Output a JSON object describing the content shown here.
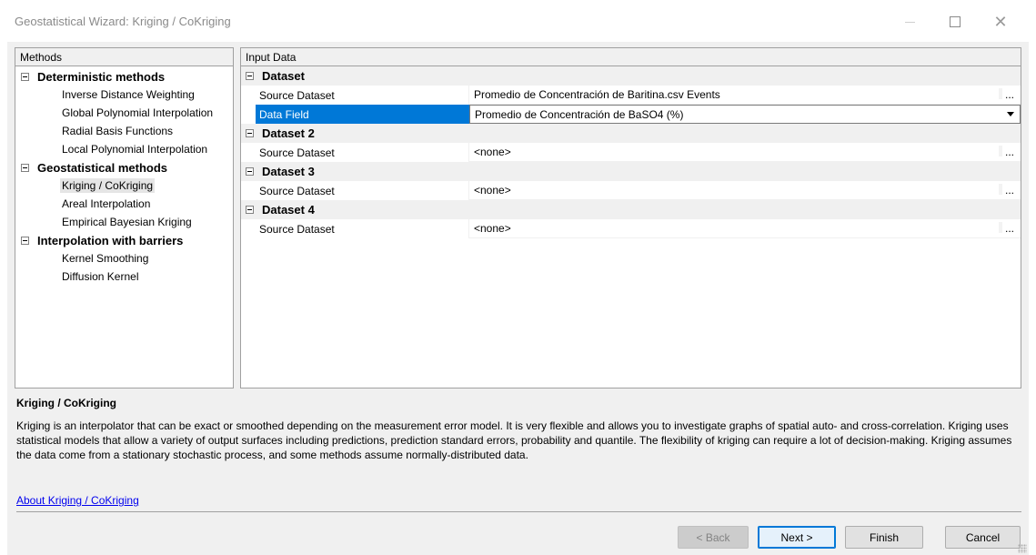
{
  "window": {
    "title": "Geostatistical Wizard: Kriging / CoKriging"
  },
  "methods": {
    "header": "Methods",
    "groups": [
      {
        "label": "Deterministic methods",
        "items": [
          "Inverse Distance Weighting",
          "Global Polynomial Interpolation",
          "Radial Basis Functions",
          "Local Polynomial Interpolation"
        ]
      },
      {
        "label": "Geostatistical methods",
        "items": [
          "Kriging / CoKriging",
          "Areal Interpolation",
          "Empirical Bayesian Kriging"
        ]
      },
      {
        "label": "Interpolation with barriers",
        "items": [
          "Kernel Smoothing",
          "Diffusion Kernel"
        ]
      }
    ],
    "selected": "Kriging / CoKriging"
  },
  "input_data": {
    "header": "Input Data",
    "sections": [
      {
        "label": "Dataset",
        "rows": [
          {
            "name": "Source Dataset",
            "value": "Promedio de Concentración de Baritina.csv Events"
          },
          {
            "name": "Data Field",
            "value": "Promedio de Concentración de BaSO4 (%)"
          }
        ]
      },
      {
        "label": "Dataset 2",
        "rows": [
          {
            "name": "Source Dataset",
            "value": "<none>"
          }
        ]
      },
      {
        "label": "Dataset 3",
        "rows": [
          {
            "name": "Source Dataset",
            "value": "<none>"
          }
        ]
      },
      {
        "label": "Dataset 4",
        "rows": [
          {
            "name": "Source Dataset",
            "value": "<none>"
          }
        ]
      }
    ],
    "ellipsis": "..."
  },
  "description": {
    "title": "Kriging / CoKriging",
    "text": "Kriging is an interpolator that can be exact or smoothed depending on the measurement error model. It is very flexible and allows you to investigate graphs of spatial auto- and cross-correlation. Kriging uses statistical models that allow a variety of output surfaces including predictions, prediction standard errors, probability and quantile. The flexibility of kriging can require a lot of decision-making. Kriging assumes the data come from a stationary stochastic process, and some methods assume normally-distributed data.",
    "link": "About Kriging / CoKriging"
  },
  "buttons": {
    "back": "< Back",
    "next": "Next >",
    "finish": "Finish",
    "cancel": "Cancel"
  },
  "colors": {
    "selection": "#0078d7",
    "link": "#0000ee"
  }
}
